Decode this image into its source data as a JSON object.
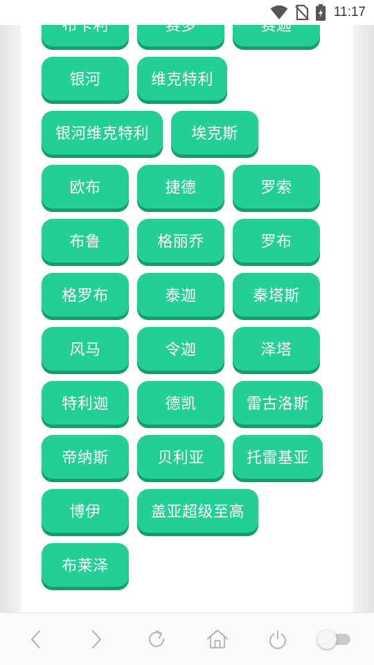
{
  "status_bar": {
    "time": "11:17",
    "icons": [
      "wifi-icon",
      "no-sim-icon",
      "battery-charging-icon"
    ]
  },
  "tags": [
    "布卡利",
    "赛多",
    "赛迦",
    "银河",
    "维克特利",
    "银河维克特利",
    "埃克斯",
    "欧布",
    "捷德",
    "罗索",
    "布鲁",
    "格丽乔",
    "罗布",
    "格罗布",
    "泰迦",
    "秦塔斯",
    "风马",
    "令迦",
    "泽塔",
    "特利迦",
    "德凯",
    "雷古洛斯",
    "帝纳斯",
    "贝利亚",
    "托雷基亚",
    "博伊",
    "盖亚超级至高",
    "布莱泽"
  ],
  "colors": {
    "tag_bg": "#24cf94",
    "tag_shadow": "#179c6d",
    "tag_text": "#ffffff"
  },
  "bottom_bar": {
    "icons": [
      "back-arrow-icon",
      "forward-arrow-icon",
      "refresh-icon",
      "home-icon",
      "power-icon",
      "toggle-switch"
    ],
    "toggle_on": false
  }
}
